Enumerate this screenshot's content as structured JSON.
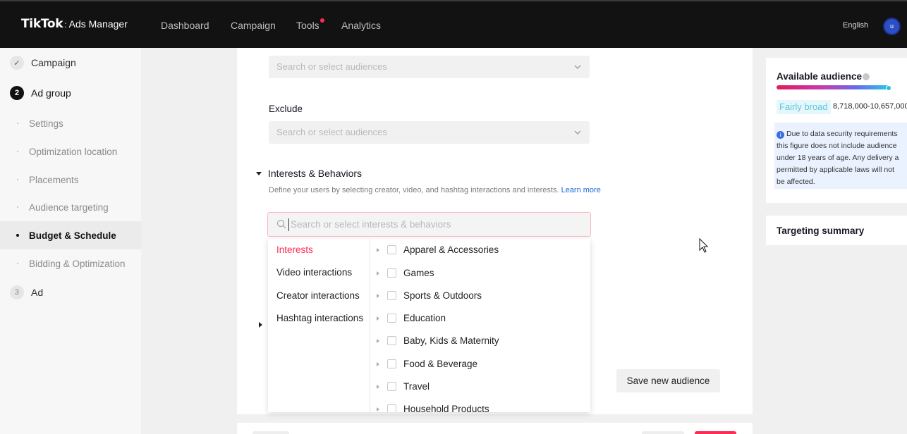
{
  "header": {
    "brand": "TikTok",
    "separator": ":",
    "product": "Ads Manager",
    "nav": [
      "Dashboard",
      "Campaign",
      "Tools",
      "Analytics"
    ],
    "language": "English",
    "avatar_initial": "u"
  },
  "sidebar": {
    "steps": [
      {
        "badge": "✓",
        "label": "Campaign"
      },
      {
        "badge": "2",
        "label": "Ad group"
      },
      {
        "badge": "3",
        "label": "Ad"
      }
    ],
    "substeps": [
      "Settings",
      "Optimization location",
      "Placements",
      "Audience targeting",
      "Budget & Schedule",
      "Bidding & Optimization"
    ]
  },
  "main": {
    "include_placeholder": "Search or select audiences",
    "exclude_label": "Exclude",
    "exclude_placeholder": "Search or select audiences",
    "interests_title": "Interests & Behaviors",
    "interests_desc": "Define your users by selecting creator, video, and hashtag interactions and interests.",
    "learn_more": "Learn more",
    "search_placeholder": "Search or select interests & behaviors",
    "categories": [
      "Interests",
      "Video interactions",
      "Creator interactions",
      "Hashtag interactions"
    ],
    "interest_items": [
      "Apparel & Accessories",
      "Games",
      "Sports & Outdoors",
      "Education",
      "Baby, Kids & Maternity",
      "Food & Beverage",
      "Travel",
      "Household Products"
    ],
    "save_audience": "Save new audience"
  },
  "right_panel": {
    "available_title": "Available audience",
    "breadth": "Fairly broad",
    "range": "8,718,000-10,657,000",
    "note": "Due to data security requirements\nthis figure does not include audience\nunder 18 years of age. Any delivery a\npermitted by applicable laws will not\nbe affected.",
    "summary_title": "Targeting summary"
  },
  "colors": {
    "accent": "#fe2c55",
    "topbar": "#121212",
    "link": "#1b6ad6"
  }
}
